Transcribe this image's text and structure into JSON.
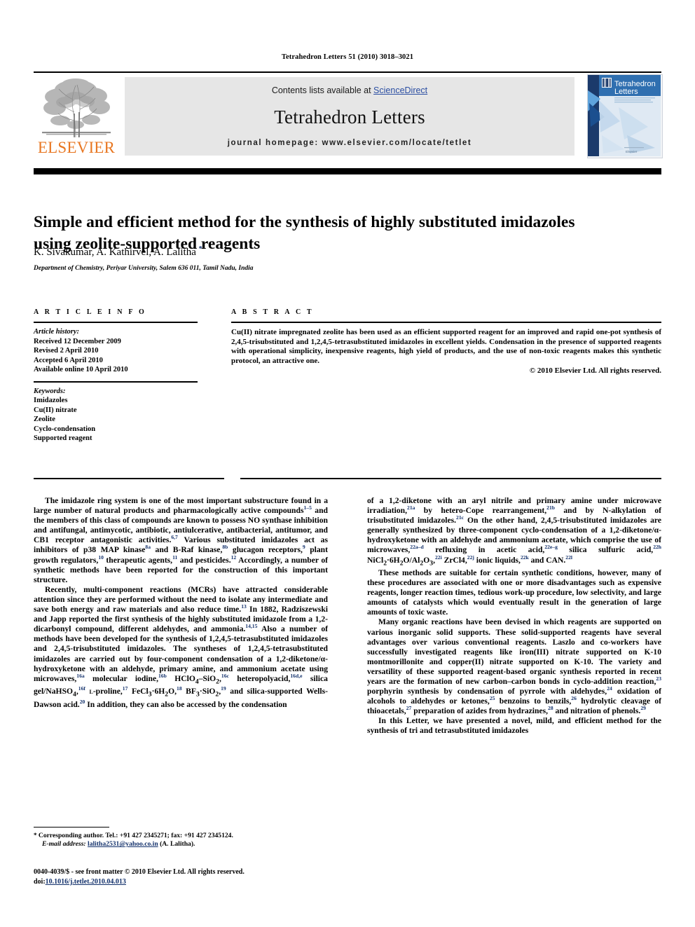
{
  "running_head": "Tetrahedron Letters 51 (2010) 3018–3021",
  "masthead": {
    "contents_prefix": "Contents lists available at ",
    "sciencedirect": "ScienceDirect",
    "journal_title": "Tetrahedron Letters",
    "homepage": "journal homepage: www.elsevier.com/locate/tetlet",
    "publisher_wordmark": "ELSEVIER",
    "cover_title_line1": "Tetrahedron",
    "cover_title_line2": "Letters",
    "cover_publisher": "Elsevier",
    "accent_orange": "#E87722",
    "link_blue": "#2b4ea2"
  },
  "article": {
    "title": "Simple and efficient method for the synthesis of highly substituted imidazoles using zeolite-supported reagents",
    "authors_html": "K. Sivakumar, A. Kathirvel, A. Lalitha <sup>*</sup>",
    "affiliation": "Department of Chemistry, Periyar University, Salem 636 011, Tamil Nadu, India"
  },
  "info": {
    "heading": "A R T I C L E    I N F O",
    "history_label": "Article history:",
    "history": [
      "Received 12 December 2009",
      "Revised 2 April 2010",
      "Accepted 6 April 2010",
      "Available online 10 April 2010"
    ],
    "keywords_label": "Keywords:",
    "keywords": [
      "Imidazoles",
      "Cu(II) nitrate",
      "Zeolite",
      "Cyclo-condensation",
      "Supported reagent"
    ]
  },
  "abstract": {
    "heading": "A B S T R A C T",
    "text": "Cu(II) nitrate impregnated zeolite has been used as an efficient supported reagent for an improved and rapid one-pot synthesis of 2,4,5-trisubstituted and 1,2,4,5-tetrasubstituted imidazoles in excellent yields. Condensation in the presence of supported reagents with operational simplicity, inexpensive reagents, high yield of products, and the use of non-toxic reagents makes this synthetic protocol, an attractive one.",
    "copyright": "© 2010 Elsevier Ltd. All rights reserved."
  },
  "body": {
    "left_paragraphs_html": [
      "The imidazole ring system is one of the most important substructure found in a large number of natural products and pharmacologically active compounds<sup>1–5</sup> and the members of this class of compounds are known to possess NO synthase inhibition and antifungal, antimycotic, antibiotic, antiulcerative, antibacterial, antitumor, and CB1 receptor antagonistic activities.<sup>6,7</sup> Various substituted imidazoles act as inhibitors of p38 MAP kinase<sup>8a</sup> and B-Raf kinase,<sup>8b</sup> glucagon receptors,<sup>9</sup> plant growth regulators,<sup>10</sup> therapeutic agents,<sup>11</sup> and pesticides.<sup>12</sup> Accordingly, a number of synthetic methods have been reported for the construction of this important structure.",
      "Recently, multi-component reactions (MCRs) have attracted considerable attention since they are performed without the need to isolate any intermediate and save both energy and raw materials and also reduce time.<sup>13</sup> In 1882, Radziszewski and Japp reported the first synthesis of the highly substituted imidazole from a 1,2-dicarbonyl compound, different aldehydes, and ammonia.<sup>14,15</sup> Also a number of methods have been developed for the synthesis of 1,2,4,5-tetrasubstituted imidazoles and 2,4,5-trisubstituted imidazoles. The syntheses of 1,2,4,5-tetrasubstituted imidazoles are carried out by four-component condensation of a 1,2-diketone/α-hydroxyketone with an aldehyde, primary amine, and ammonium acetate using microwaves,<sup>16a</sup> molecular iodine,<sup>16b</sup> HClO<sub>4</sub>–SiO<sub>2</sub>,<sup>16c</sup> heteropolyacid,<sup>16d,e</sup> silica gel/NaHSO<sub>4</sub>,<sup>16f</sup> <span class=\"smallcaps\">l</span>-proline,<sup>17</sup> FeCl<sub>3</sub>·6H<sub>2</sub>O,<sup>18</sup> BF<sub>3</sub>·SiO<sub>2</sub>,<sup>19</sup> and silica-supported Wells-Dawson acid.<sup>20</sup> In addition, they can also be accessed by the condensation"
    ],
    "right_paragraphs_html": [
      "of a 1,2-diketone with an aryl nitrile and primary amine under microwave irradiation,<sup>21a</sup> by hetero-Cope rearrangement,<sup>21b</sup> and by N-alkylation of trisubstituted imidazoles.<sup>21c</sup> On the other hand, 2,4,5-trisubstituted imidazoles are generally synthesized by three-component cyclo-condensation of a 1,2-diketone/α-hydroxyketone with an aldehyde and ammonium acetate, which comprise the use of microwaves,<sup>22a–d</sup> refluxing in acetic acid,<sup>22e–g</sup> silica sulfuric acid,<sup>22h</sup> NiCl<sub>2</sub>·6H<sub>2</sub>O/Al<sub>2</sub>O<sub>3</sub>,<sup>22i</sup> ZrCl4,<sup>22j</sup> ionic liquids,<sup>22k</sup> and CAN.<sup>22l</sup>",
      "These methods are suitable for certain synthetic conditions, however, many of these procedures are associated with one or more disadvantages such as expensive reagents, longer reaction times, tedious work-up procedure, low selectivity, and large amounts of catalysts which would eventually result in the generation of large amounts of toxic waste.",
      "Many organic reactions have been devised in which reagents are supported on various inorganic solid supports. These solid-supported reagents have several advantages over various conventional reagents. Laszlo and co-workers have successfully investigated reagents like iron(III) nitrate supported on K-10 montmorillonite and copper(II) nitrate supported on K-10. The variety and versatility of these supported reagent-based organic synthesis reported in recent years are the formation of new carbon–carbon bonds in cyclo-addition reaction,<sup>23</sup> porphyrin synthesis by condensation of pyrrole with aldehydes,<sup>24</sup> oxidation of alcohols to aldehydes or ketones,<sup>25</sup> benzoins to benzils,<sup>26</sup> hydrolytic cleavage of thioacetals,<sup>27</sup> preparation of azides from hydrazines,<sup>28</sup> and nitration of phenols.<sup>29</sup>",
      "In this Letter, we have presented a novel, mild, and efficient method for the synthesis of tri and tetrasubstituted imidazoles"
    ]
  },
  "footnote": {
    "corresponding_html": "<span class=\"star\">*</span> Corresponding author. Tel.: +91 427 2345271; fax: +91 427 2345124.",
    "email_label": "E-mail address:",
    "email": "lalitha2531@yahoo.co.in",
    "email_owner": "(A. Lalitha)."
  },
  "imprint": {
    "line1": "0040-4039/$ - see front matter © 2010 Elsevier Ltd. All rights reserved.",
    "doi_label": "doi:",
    "doi": "10.1016/j.tetlet.2010.04.013"
  }
}
